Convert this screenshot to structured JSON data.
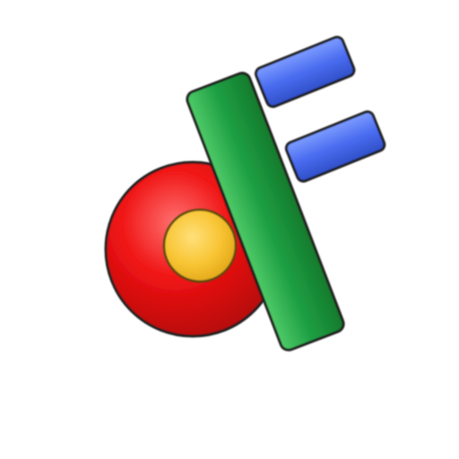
{
  "logo": {
    "icon_name": "app-logo-icon",
    "shapes": {
      "ring": {
        "name": "red-ring",
        "color": "#e20f12"
      },
      "dot": {
        "name": "yellow-dot",
        "color": "#f8c433"
      },
      "stem": {
        "name": "green-bar",
        "color": "#1c9a3c"
      },
      "arm_top": {
        "name": "blue-bar-top",
        "color": "#3f63e8"
      },
      "arm_middle": {
        "name": "blue-bar-middle",
        "color": "#3f63e8"
      }
    },
    "colors": {
      "background": "#ffffff",
      "outline": "#1f1f1f",
      "red": "#e20f12",
      "yellow": "#f8c433",
      "green": "#1c9a3c",
      "blue": "#3f63e8"
    }
  }
}
